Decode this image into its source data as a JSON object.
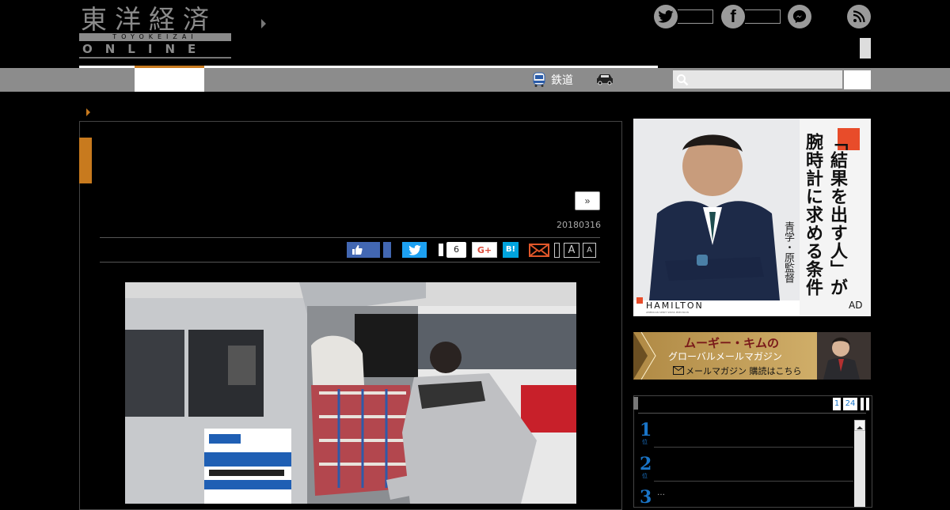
{
  "header": {
    "logo_kanji": "東洋経済",
    "logo_romaji": "TOYOKEIZAI",
    "logo_online": "ONLINE"
  },
  "nav": {
    "items": [
      {
        "label": "鉄道",
        "icon": "train-icon"
      },
      {
        "label": "",
        "icon": "car-icon"
      }
    ],
    "search": {
      "placeholder": "",
      "value": ""
    }
  },
  "article": {
    "next_label": "»",
    "date": "20180316",
    "share": {
      "twitter_icon": "twitter-bird-icon",
      "pocket_count": "6",
      "gplus_label": "G+",
      "hatena_label": "B!",
      "font_large": "A",
      "font_small": "A"
    }
  },
  "ads": {
    "hamilton": {
      "headline_lines": [
        "「結果を出す人」が",
        "腕時計に求める条件"
      ],
      "byline": "青学・原監督",
      "brand": "HAMILTON",
      "brand_sub": "AMERICAN SPIRIT SWISS PRECISION",
      "ad_label": "AD"
    },
    "newsletter": {
      "title": "ムーギー・キムの",
      "subtitle": "グローバルメールマガジン",
      "cta": "メールマガジン 購読はこちら"
    }
  },
  "ranking": {
    "pages": [
      "1",
      "24"
    ],
    "rows": [
      {
        "rank": "1",
        "sub": "位"
      },
      {
        "rank": "2",
        "sub": "位"
      },
      {
        "rank": "3",
        "sub": "…"
      }
    ]
  },
  "colors": {
    "accent_orange": "#c87a1e",
    "nav_gray": "#8c8c8c",
    "facebook_blue": "#4267b2",
    "twitter_blue": "#1da1f2",
    "hatena_blue": "#00a4de",
    "rank_blue": "#1a75c8"
  }
}
